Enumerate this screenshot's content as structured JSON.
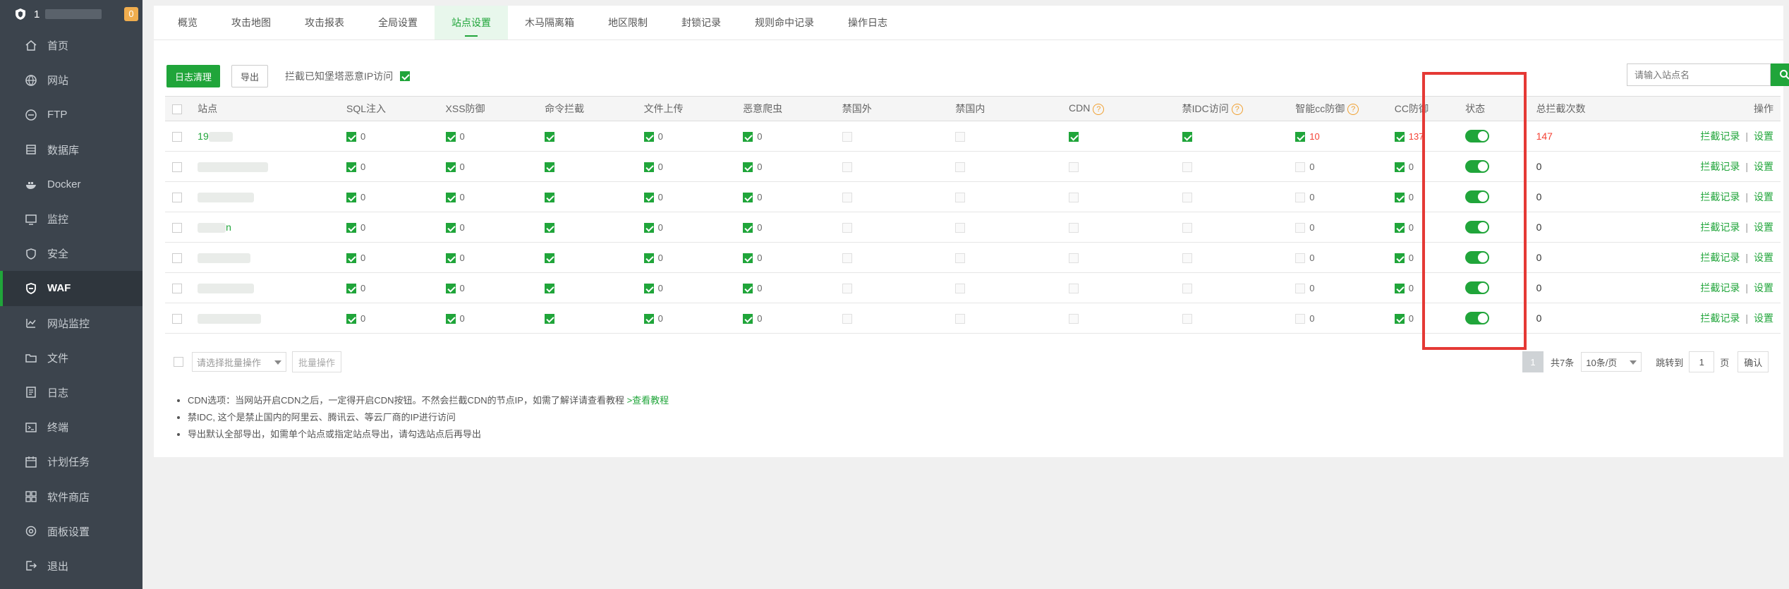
{
  "sidebar": {
    "host": "1",
    "badge": "0",
    "items": [
      {
        "label": "首页",
        "icon": "home-icon"
      },
      {
        "label": "网站",
        "icon": "globe-icon"
      },
      {
        "label": "FTP",
        "icon": "ftp-icon"
      },
      {
        "label": "数据库",
        "icon": "database-icon"
      },
      {
        "label": "Docker",
        "icon": "docker-icon"
      },
      {
        "label": "监控",
        "icon": "monitor-icon"
      },
      {
        "label": "安全",
        "icon": "shield-icon"
      },
      {
        "label": "WAF",
        "icon": "waf-icon"
      },
      {
        "label": "网站监控",
        "icon": "site-monitor-icon"
      },
      {
        "label": "文件",
        "icon": "folder-icon"
      },
      {
        "label": "日志",
        "icon": "log-icon"
      },
      {
        "label": "终端",
        "icon": "terminal-icon"
      },
      {
        "label": "计划任务",
        "icon": "cron-icon"
      },
      {
        "label": "软件商店",
        "icon": "store-icon"
      },
      {
        "label": "面板设置",
        "icon": "settings-icon"
      },
      {
        "label": "退出",
        "icon": "logout-icon"
      }
    ]
  },
  "tabs": [
    "概览",
    "攻击地图",
    "攻击报表",
    "全局设置",
    "站点设置",
    "木马隔离箱",
    "地区限制",
    "封锁记录",
    "规则命中记录",
    "操作日志"
  ],
  "toolbar": {
    "log_clean": "日志清理",
    "export": "导出",
    "block_label": "拦截已知堡塔恶意IP访问"
  },
  "search": {
    "placeholder": "请输入站点名"
  },
  "columns": [
    "站点",
    "SQL注入",
    "XSS防御",
    "命令拦截",
    "文件上传",
    "恶意爬虫",
    "禁国外",
    "禁国内",
    "CDN",
    "禁IDC访问",
    "智能cc防御",
    "CC防御",
    "状态",
    "总拦截次数",
    "操作"
  ],
  "rows": [
    {
      "site": "19",
      "site_tail": "",
      "sql": "0",
      "xss": "0",
      "file": "0",
      "crawler": "0",
      "smartcc": "10",
      "cc": "137",
      "total": "147"
    },
    {
      "site": "",
      "site_tail": "",
      "sql": "0",
      "xss": "0",
      "file": "0",
      "crawler": "0",
      "smartcc": "0",
      "cc": "0",
      "total": "0"
    },
    {
      "site": "",
      "site_tail": "",
      "sql": "0",
      "xss": "0",
      "file": "0",
      "crawler": "0",
      "smartcc": "0",
      "cc": "0",
      "total": "0"
    },
    {
      "site": "",
      "site_tail": "n",
      "sql": "0",
      "xss": "0",
      "file": "0",
      "crawler": "0",
      "smartcc": "0",
      "cc": "0",
      "total": "0"
    },
    {
      "site": "",
      "site_tail": "",
      "sql": "0",
      "xss": "0",
      "file": "0",
      "crawler": "0",
      "smartcc": "0",
      "cc": "0",
      "total": "0"
    },
    {
      "site": "",
      "site_tail": "",
      "sql": "0",
      "xss": "0",
      "file": "0",
      "crawler": "0",
      "smartcc": "0",
      "cc": "0",
      "total": "0"
    },
    {
      "site": "",
      "site_tail": "",
      "sql": "0",
      "xss": "0",
      "file": "0",
      "crawler": "0",
      "smartcc": "0",
      "cc": "0",
      "total": "0"
    }
  ],
  "row_actions": {
    "log": "拦截记录",
    "sep": "|",
    "settings": "设置"
  },
  "bottom": {
    "batch_placeholder": "请选择批量操作",
    "batch_button": "批量操作"
  },
  "pager": {
    "page": "1",
    "total": "共7条",
    "size": "10条/页",
    "jump": "跳转到",
    "jump_value": "1",
    "unit": "页",
    "confirm": "确认"
  },
  "notes": {
    "cdn": "CDN选项：当网站开启CDN之后，一定得开启CDN按钮。不然会拦截CDN的节点IP，如需了解详请查看教程",
    "cdn_link": ">查看教程",
    "idc": "禁IDC, 这个是禁止国内的阿里云、腾讯云、等云厂商的IP进行访问",
    "export": "导出默认全部导出，如需单个站点或指定站点导出，请勾选站点后再导出"
  },
  "colors": {
    "accent": "#20a53a",
    "highlight": "#e53935",
    "sidebar": "#3c444d"
  }
}
